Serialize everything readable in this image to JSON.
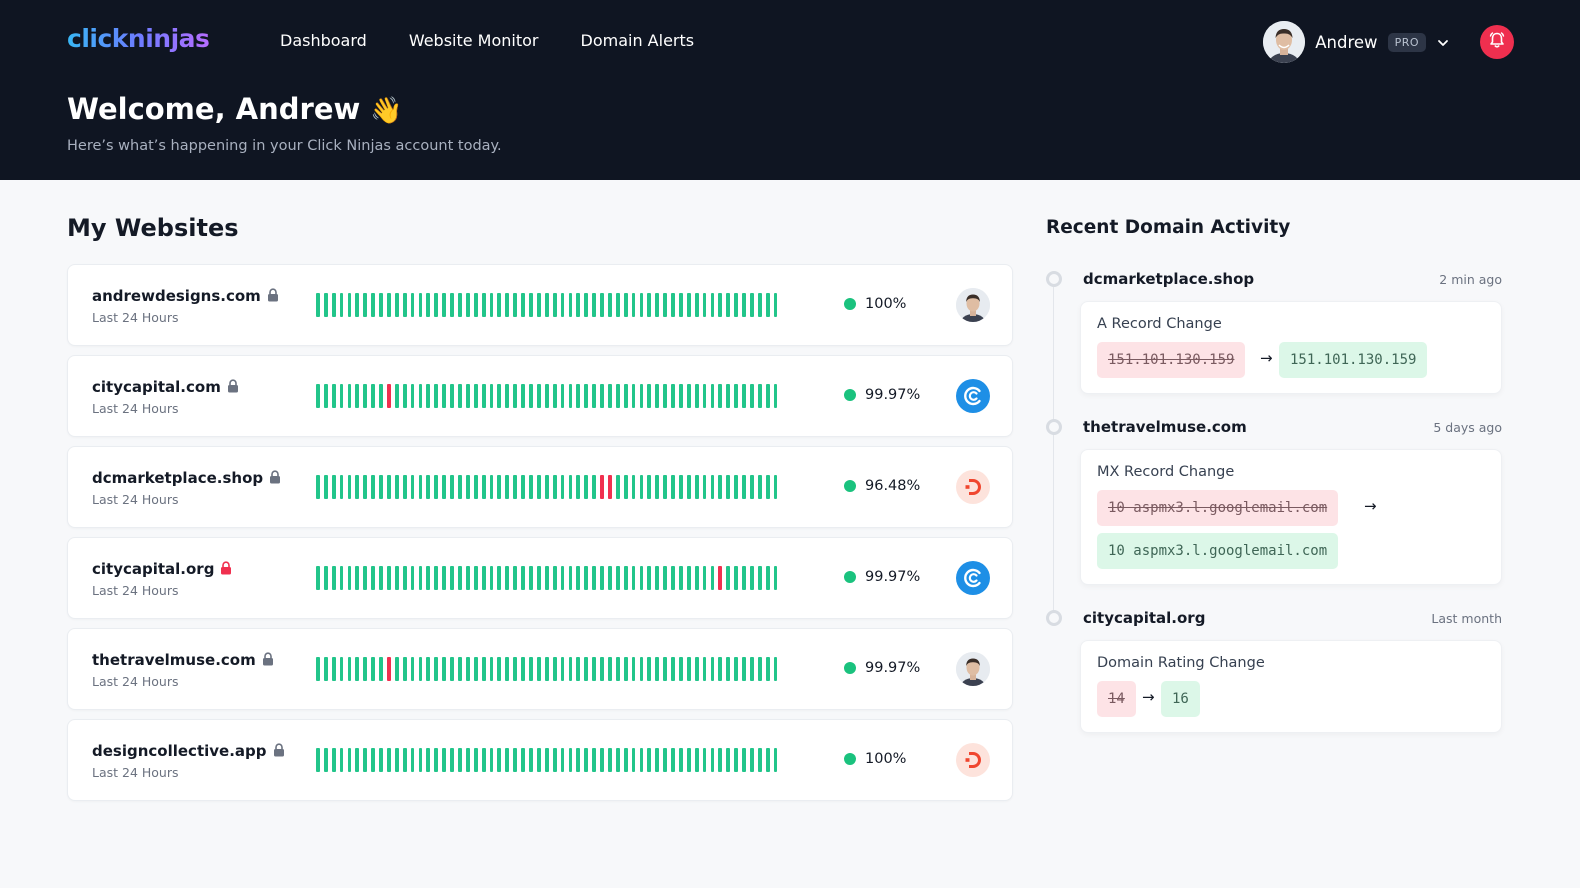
{
  "app": {
    "logo": "clickninjas"
  },
  "nav": {
    "items": [
      {
        "label": "Dashboard"
      },
      {
        "label": "Website Monitor"
      },
      {
        "label": "Domain Alerts"
      }
    ]
  },
  "user": {
    "name": "Andrew",
    "badge": "PRO"
  },
  "header": {
    "welcome": "Welcome, Andrew",
    "wave_emoji": "👋",
    "subtitle": "Here’s  what’s happening in your Click Ninjas account today."
  },
  "websites": {
    "title": "My Websites",
    "items": [
      {
        "domain": "andrewdesigns.com",
        "sub": "Last 24 Hours",
        "uptime": "100%",
        "lock_color": "#6b7280",
        "icon": "avatar-icon",
        "down_bars": []
      },
      {
        "domain": "citycapital.com",
        "sub": "Last 24 Hours",
        "uptime": "99.97%",
        "lock_color": "#6b7280",
        "icon": "c-logo-icon",
        "down_bars": [
          9
        ]
      },
      {
        "domain": "dcmarketplace.shop",
        "sub": "Last 24 Hours",
        "uptime": "96.48%",
        "lock_color": "#6b7280",
        "icon": "d-logo-icon",
        "down_bars": [
          36,
          37
        ]
      },
      {
        "domain": "citycapital.org",
        "sub": "Last 24 Hours",
        "uptime": "99.97%",
        "lock_color": "#f0304f",
        "icon": "c-logo-icon",
        "down_bars": [
          51
        ]
      },
      {
        "domain": "thetravelmuse.com",
        "sub": "Last 24 Hours",
        "uptime": "99.97%",
        "lock_color": "#6b7280",
        "icon": "avatar-icon",
        "down_bars": [
          9
        ]
      },
      {
        "domain": "designcollective.app",
        "sub": "Last 24 Hours",
        "uptime": "100%",
        "lock_color": "#6b7280",
        "icon": "d-logo-icon",
        "down_bars": []
      }
    ],
    "bar_count": 59,
    "colors": {
      "up": "#22c58a",
      "down": "#f0304f"
    }
  },
  "activity": {
    "title": "Recent Domain Activity",
    "items": [
      {
        "domain": "dcmarketplace.shop",
        "time": "2 min ago",
        "type": "A Record Change",
        "old": "151.101.130.159",
        "new": "151.101.130.159"
      },
      {
        "domain": "thetravelmuse.com",
        "time": "5 days ago",
        "type": "MX Record Change",
        "old": "10 aspmx3.l.googlemail.com",
        "new": "10 aspmx3.l.googlemail.com"
      },
      {
        "domain": "citycapital.org",
        "time": "Last month",
        "type": "Domain Rating Change",
        "old": "14",
        "new": "16"
      }
    ],
    "arrow": "→"
  }
}
